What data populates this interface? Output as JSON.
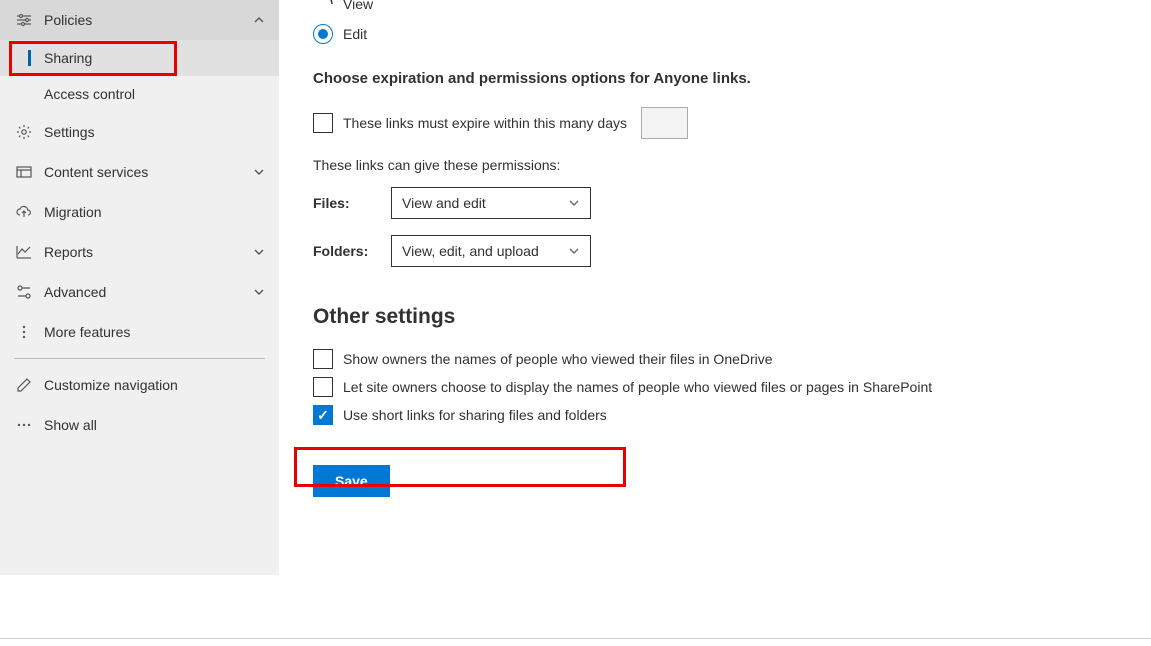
{
  "sidebar": {
    "policies": "Policies",
    "sharing": "Sharing",
    "access_control": "Access control",
    "settings": "Settings",
    "content_services": "Content services",
    "migration": "Migration",
    "reports": "Reports",
    "advanced": "Advanced",
    "more_features": "More features",
    "customize_navigation": "Customize navigation",
    "show_all": "Show all"
  },
  "radio": {
    "view": "View",
    "edit": "Edit"
  },
  "expiration": {
    "heading": "Choose expiration and permissions options for Anyone links.",
    "expire_label": "These links must expire within this many days",
    "permissions_note": "These links can give these permissions:",
    "files_label": "Files:",
    "files_value": "View and edit",
    "folders_label": "Folders:",
    "folders_value": "View, edit, and upload"
  },
  "other": {
    "heading": "Other settings",
    "show_owners": "Show owners the names of people who viewed their files in OneDrive",
    "let_site_owners": "Let site owners choose to display the names of people who viewed files or pages in SharePoint",
    "short_links": "Use short links for sharing files and folders"
  },
  "save": "Save"
}
